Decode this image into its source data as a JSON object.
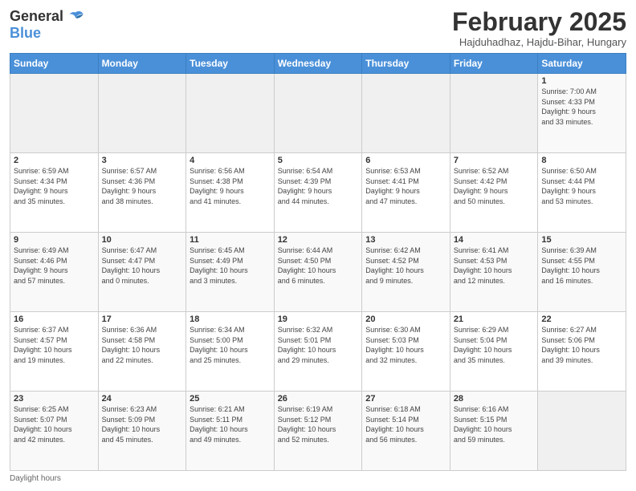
{
  "header": {
    "logo_line1": "General",
    "logo_line2": "Blue",
    "title": "February 2025",
    "subtitle": "Hajduhadhaz, Hajdu-Bihar, Hungary"
  },
  "days_of_week": [
    "Sunday",
    "Monday",
    "Tuesday",
    "Wednesday",
    "Thursday",
    "Friday",
    "Saturday"
  ],
  "weeks": [
    [
      {
        "day": "",
        "info": ""
      },
      {
        "day": "",
        "info": ""
      },
      {
        "day": "",
        "info": ""
      },
      {
        "day": "",
        "info": ""
      },
      {
        "day": "",
        "info": ""
      },
      {
        "day": "",
        "info": ""
      },
      {
        "day": "1",
        "info": "Sunrise: 7:00 AM\nSunset: 4:33 PM\nDaylight: 9 hours\nand 33 minutes."
      }
    ],
    [
      {
        "day": "2",
        "info": "Sunrise: 6:59 AM\nSunset: 4:34 PM\nDaylight: 9 hours\nand 35 minutes."
      },
      {
        "day": "3",
        "info": "Sunrise: 6:57 AM\nSunset: 4:36 PM\nDaylight: 9 hours\nand 38 minutes."
      },
      {
        "day": "4",
        "info": "Sunrise: 6:56 AM\nSunset: 4:38 PM\nDaylight: 9 hours\nand 41 minutes."
      },
      {
        "day": "5",
        "info": "Sunrise: 6:54 AM\nSunset: 4:39 PM\nDaylight: 9 hours\nand 44 minutes."
      },
      {
        "day": "6",
        "info": "Sunrise: 6:53 AM\nSunset: 4:41 PM\nDaylight: 9 hours\nand 47 minutes."
      },
      {
        "day": "7",
        "info": "Sunrise: 6:52 AM\nSunset: 4:42 PM\nDaylight: 9 hours\nand 50 minutes."
      },
      {
        "day": "8",
        "info": "Sunrise: 6:50 AM\nSunset: 4:44 PM\nDaylight: 9 hours\nand 53 minutes."
      }
    ],
    [
      {
        "day": "9",
        "info": "Sunrise: 6:49 AM\nSunset: 4:46 PM\nDaylight: 9 hours\nand 57 minutes."
      },
      {
        "day": "10",
        "info": "Sunrise: 6:47 AM\nSunset: 4:47 PM\nDaylight: 10 hours\nand 0 minutes."
      },
      {
        "day": "11",
        "info": "Sunrise: 6:45 AM\nSunset: 4:49 PM\nDaylight: 10 hours\nand 3 minutes."
      },
      {
        "day": "12",
        "info": "Sunrise: 6:44 AM\nSunset: 4:50 PM\nDaylight: 10 hours\nand 6 minutes."
      },
      {
        "day": "13",
        "info": "Sunrise: 6:42 AM\nSunset: 4:52 PM\nDaylight: 10 hours\nand 9 minutes."
      },
      {
        "day": "14",
        "info": "Sunrise: 6:41 AM\nSunset: 4:53 PM\nDaylight: 10 hours\nand 12 minutes."
      },
      {
        "day": "15",
        "info": "Sunrise: 6:39 AM\nSunset: 4:55 PM\nDaylight: 10 hours\nand 16 minutes."
      }
    ],
    [
      {
        "day": "16",
        "info": "Sunrise: 6:37 AM\nSunset: 4:57 PM\nDaylight: 10 hours\nand 19 minutes."
      },
      {
        "day": "17",
        "info": "Sunrise: 6:36 AM\nSunset: 4:58 PM\nDaylight: 10 hours\nand 22 minutes."
      },
      {
        "day": "18",
        "info": "Sunrise: 6:34 AM\nSunset: 5:00 PM\nDaylight: 10 hours\nand 25 minutes."
      },
      {
        "day": "19",
        "info": "Sunrise: 6:32 AM\nSunset: 5:01 PM\nDaylight: 10 hours\nand 29 minutes."
      },
      {
        "day": "20",
        "info": "Sunrise: 6:30 AM\nSunset: 5:03 PM\nDaylight: 10 hours\nand 32 minutes."
      },
      {
        "day": "21",
        "info": "Sunrise: 6:29 AM\nSunset: 5:04 PM\nDaylight: 10 hours\nand 35 minutes."
      },
      {
        "day": "22",
        "info": "Sunrise: 6:27 AM\nSunset: 5:06 PM\nDaylight: 10 hours\nand 39 minutes."
      }
    ],
    [
      {
        "day": "23",
        "info": "Sunrise: 6:25 AM\nSunset: 5:07 PM\nDaylight: 10 hours\nand 42 minutes."
      },
      {
        "day": "24",
        "info": "Sunrise: 6:23 AM\nSunset: 5:09 PM\nDaylight: 10 hours\nand 45 minutes."
      },
      {
        "day": "25",
        "info": "Sunrise: 6:21 AM\nSunset: 5:11 PM\nDaylight: 10 hours\nand 49 minutes."
      },
      {
        "day": "26",
        "info": "Sunrise: 6:19 AM\nSunset: 5:12 PM\nDaylight: 10 hours\nand 52 minutes."
      },
      {
        "day": "27",
        "info": "Sunrise: 6:18 AM\nSunset: 5:14 PM\nDaylight: 10 hours\nand 56 minutes."
      },
      {
        "day": "28",
        "info": "Sunrise: 6:16 AM\nSunset: 5:15 PM\nDaylight: 10 hours\nand 59 minutes."
      },
      {
        "day": "",
        "info": ""
      }
    ]
  ],
  "footer": "Daylight hours"
}
